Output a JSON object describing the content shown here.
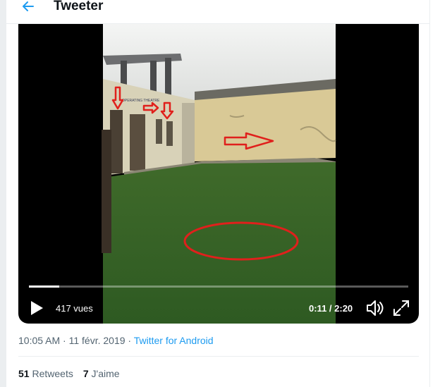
{
  "header": {
    "title": "Tweeter",
    "back_icon": "arrow-left-icon"
  },
  "video": {
    "views": "417 vues",
    "time": "0:11 / 2:20",
    "progress": 0.079,
    "icons": [
      "play-icon",
      "volume-icon",
      "fullscreen-icon"
    ],
    "sign_text": "OPERATING THEATRE"
  },
  "meta": {
    "time": "10:05 AM",
    "sep1": " · ",
    "date": "11 févr. 2019",
    "sep2": " · ",
    "source": "Twitter for Android"
  },
  "stats": {
    "retweets_count": "51",
    "retweets_label": "Retweets",
    "likes_count": "7",
    "likes_label": "J'aime"
  },
  "colors": {
    "accent": "#1d9bf0",
    "annotation": "#e0201c",
    "text_secondary": "#536471"
  }
}
